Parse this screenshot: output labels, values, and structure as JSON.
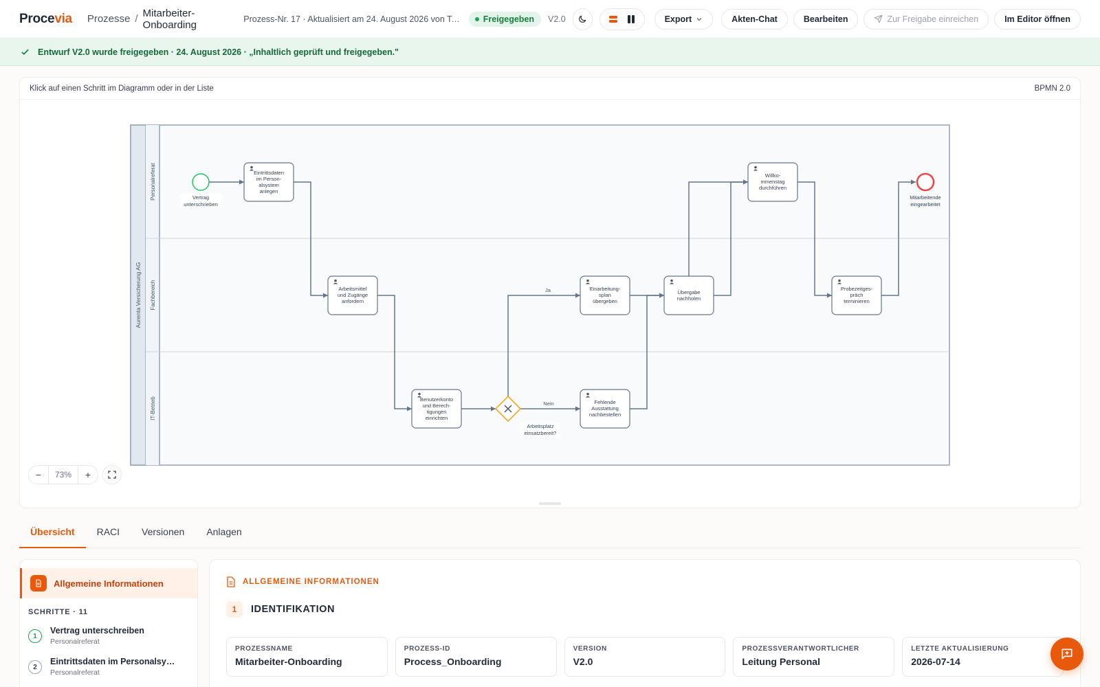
{
  "header": {
    "logo_main": "Proce",
    "logo_accent": "via",
    "breadcrumb_root": "Prozesse",
    "breadcrumb_separator": "/",
    "breadcrumb_current": "Mitarbeiter-Onboarding",
    "meta": "Prozess-Nr. 17 · Aktualisiert am 24. August 2026 von Team O...",
    "status": "Freigegeben",
    "version": "V2.0",
    "buttons": {
      "export": "Export",
      "chat": "Akten-Chat",
      "edit": "Bearbeiten",
      "submit": "Zur Freigabe einreichen",
      "editor": "Im Editor öffnen"
    }
  },
  "banner": {
    "text": "Entwurf V2.0 wurde freigegeben · 24. August 2026 · „Inhaltlich geprüft und freigegeben.\""
  },
  "diagram": {
    "hint": "Klick auf einen Schritt im Diagramm oder in der Liste",
    "notation": "BPMN 2.0",
    "pool": "Aurenta Versicherung AG",
    "lanes": [
      "Personalreferat",
      "Fachbereich",
      "IT-Betrieb"
    ],
    "start_event": [
      "Vertrag",
      "unterschrieben"
    ],
    "end_event": [
      "Mitarbeitende",
      "eingearbeitet"
    ],
    "tasks": {
      "t1": [
        "Eintrittsdaten",
        "im Person-",
        "alsystem",
        "anlegen"
      ],
      "t2": [
        "Arbeitsmittel",
        "und Zugänge",
        "anfordern"
      ],
      "t3": [
        "Benutzerkonto",
        "und Berech-",
        "tigungen",
        "einrichten"
      ],
      "t4": [
        "Einarbeitung-",
        "splan",
        "übergeben"
      ],
      "t5": [
        "Fehlende",
        "Ausstattung",
        "nachbestellen"
      ],
      "t6": [
        "Übergabe",
        "nachholen"
      ],
      "t7": [
        "Willko-",
        "mmenstag",
        "durchführen"
      ],
      "t8": [
        "Probezeitges-",
        "präch",
        "terminieren"
      ]
    },
    "gateway": [
      "Arbeitsplatz",
      "einsatzbereit?"
    ],
    "flow_yes": "Ja",
    "flow_no": "Nein",
    "zoom": "73%"
  },
  "tabs": [
    "Übersicht",
    "RACI",
    "Versionen",
    "Anlagen"
  ],
  "nav": {
    "active": "Allgemeine Informationen",
    "steps_heading": "SCHRITTE · 11",
    "steps": [
      {
        "num": "1",
        "title": "Vertrag unterschreiben",
        "lane": "Personalreferat"
      },
      {
        "num": "2",
        "title": "Eintrittsdaten im Personalsyste...",
        "lane": "Personalreferat"
      }
    ]
  },
  "content": {
    "section_title": "ALLGEMEINE INFORMATIONEN",
    "subsection_num": "1",
    "subsection_title": "IDENTIFIKATION",
    "fields": [
      {
        "label": "PROZESSNAME",
        "value": "Mitarbeiter-Onboarding"
      },
      {
        "label": "PROZESS-ID",
        "value": "Process_Onboarding"
      },
      {
        "label": "VERSION",
        "value": "V2.0"
      },
      {
        "label": "PROZESSVERANTWORTLICHER",
        "value": "Leitung Personal"
      },
      {
        "label": "LETZTE AKTUALISIERUNG",
        "value": "2026-07-14"
      }
    ]
  }
}
